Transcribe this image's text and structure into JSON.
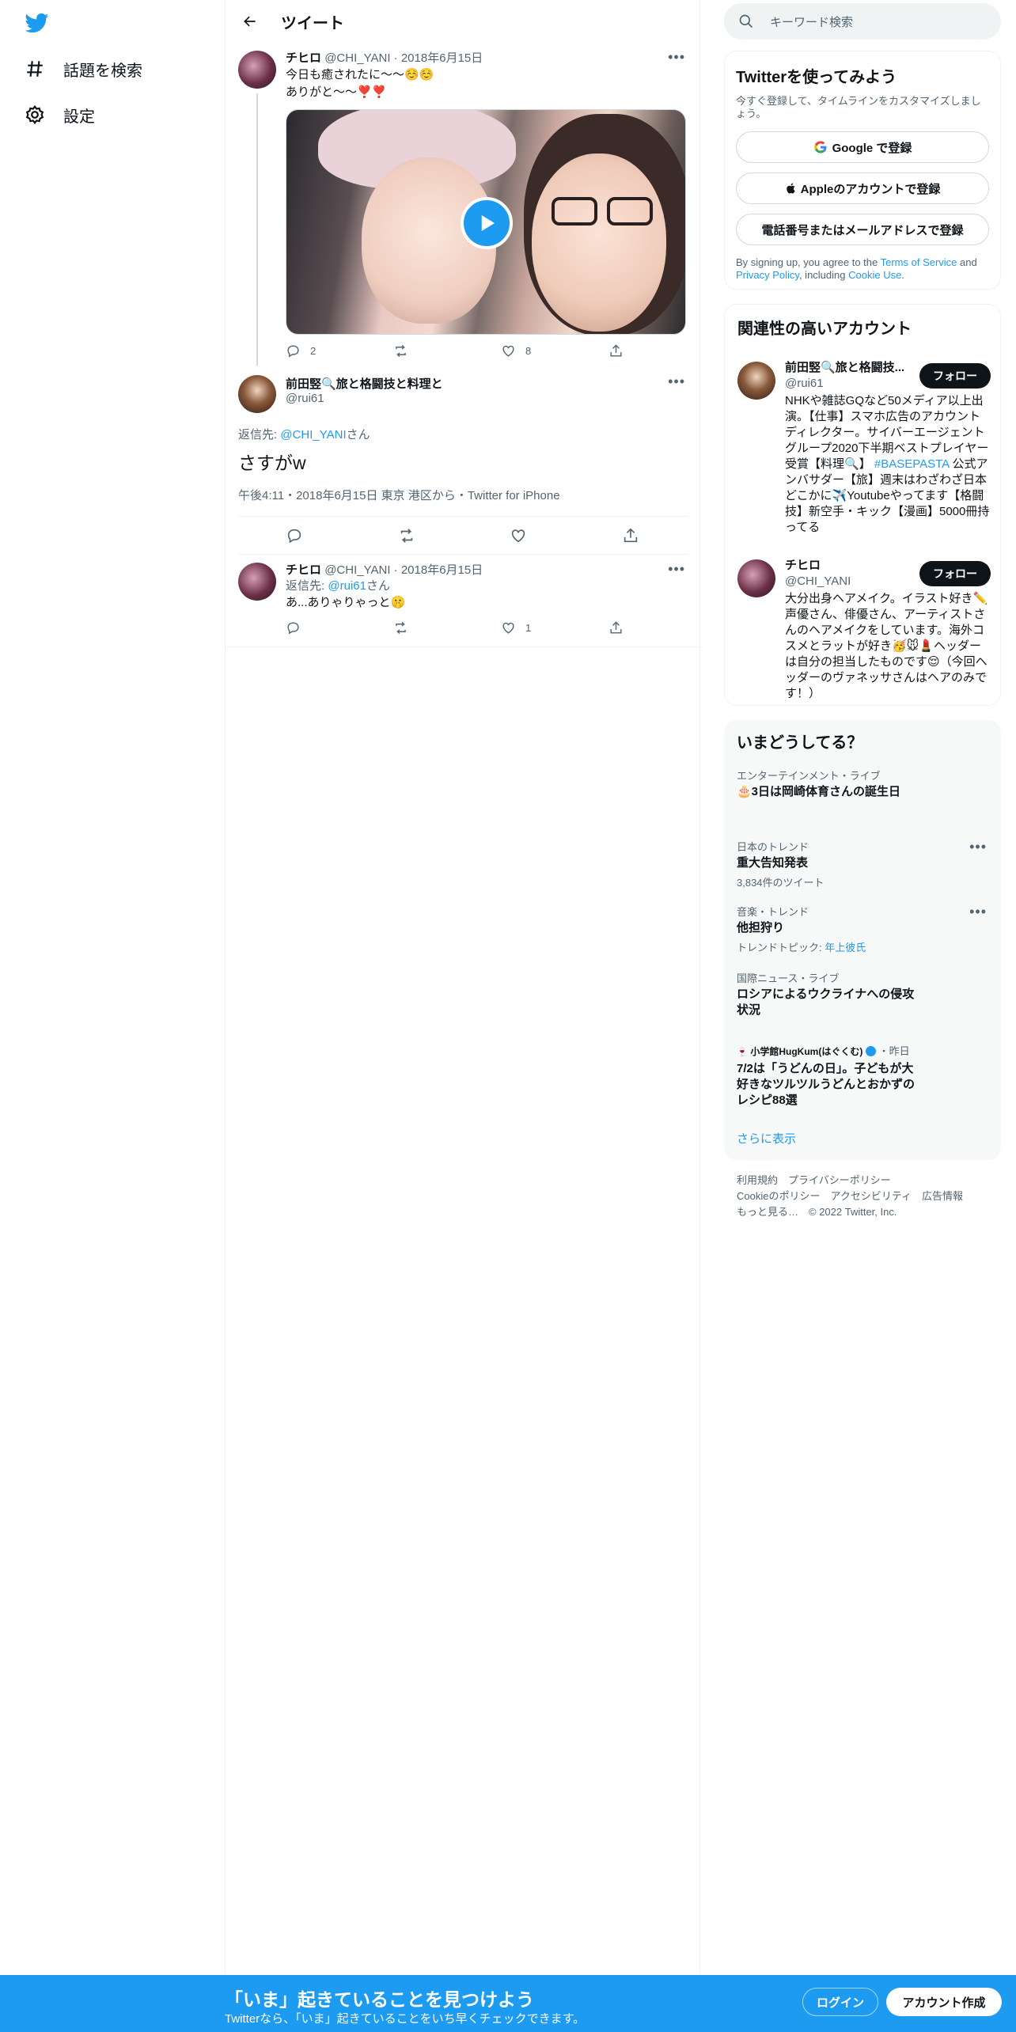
{
  "nav": {
    "explore_label": "話題を検索",
    "settings_label": "設定"
  },
  "header": {
    "title": "ツイート"
  },
  "tweet1": {
    "name": "チヒロ",
    "handle": "@CHI_YANI",
    "date": "2018年6月15日",
    "line1": "今日も癒されたに〜〜☺️☺️",
    "line2": "ありがと〜〜❣️❣️",
    "replies": "2",
    "retweets": "",
    "likes": "8"
  },
  "focus": {
    "name": "前田竪🔍旅と格闘技と料理と",
    "handle": "@rui61",
    "reply_prefix": "返信先: ",
    "reply_to": "@CHI_YANI",
    "reply_suffix": "さん",
    "text": "さすがw",
    "timeline": "午後4:11・2018年6月15日 東京 港区から・Twitter for iPhone"
  },
  "tweet3": {
    "name": "チヒロ",
    "handle": "@CHI_YANI",
    "date": "2018年6月15日",
    "reply_prefix": "返信先: ",
    "reply_to": "@rui61",
    "reply_suffix": "さん",
    "text": "あ...ありゃりゃっと🤫",
    "likes": "1"
  },
  "search": {
    "placeholder": "キーワード検索"
  },
  "signup_card": {
    "title": "Twitterを使ってみよう",
    "desc": "今すぐ登録して、タイムラインをカスタマイズしましょう。",
    "google": "Google で登録",
    "apple": "Appleのアカウントで登録",
    "phone": "電話番号またはメールアドレスで登録",
    "legal_1": "By signing up, you agree to the ",
    "terms": "Terms of Service",
    "legal_2": " and ",
    "privacy": "Privacy Policy",
    "legal_3": ", including ",
    "cookie": "Cookie Use",
    "legal_4": "."
  },
  "related": {
    "title": "関連性の高いアカウント",
    "follow_label": "フォロー",
    "accounts": [
      {
        "name": "前田竪🔍旅と格闘技...",
        "handle": "@rui61",
        "bio_1": "NHKや雑誌GQなど50メディア以上出演。【仕事】スマホ広告のアカウントディレクター。サイバーエージェントグループ2020下半期ベストプレイヤー受賞【料理🔍】",
        "bio_tag": " #BASEPASTA",
        "bio_2": " 公式アンバサダー【旅】週末はわざわざ日本どこかに✈️Youtubeやってます【格闘技】新空手・キック【漫画】5000冊持ってる"
      },
      {
        "name": "チヒロ",
        "handle": "@CHI_YANI",
        "bio_1": "大分出身ヘアメイク。イラスト好き✏️声優さん、俳優さん、アーティストさんのヘアメイクをしています。海外コスメとラットが好き🥳🐭💄ヘッダーは自分の担当したものです😌（今回ヘッダーのヴァネッサさんはヘアのみです！）"
      }
    ]
  },
  "trends": {
    "title": "いまどうしてる？",
    "items": [
      {
        "cat": "エンターテインメント・ライブ",
        "title": "🎂3日は岡崎体育さんの誕生日",
        "sub": ""
      },
      {
        "cat": "日本のトレンド",
        "title": "重大告知発表",
        "sub": "3,834件のツイート"
      },
      {
        "cat": "音楽・トレンド",
        "title": "他担狩り",
        "sub_prefix": "トレンドトピック: ",
        "sub_link": "年上彼氏"
      },
      {
        "cat": "国際ニュース・ライブ",
        "title": "ロシアによるウクライナへの侵攻状況",
        "sub": ""
      },
      {
        "cat_account": "小学館HugKum(はぐくむ)",
        "cat_time": "・昨日",
        "title": "7/2は「うどんの日」。子どもが大好きなツルツルうどんとおかずのレシピ88選"
      }
    ],
    "more": "さらに表示"
  },
  "footer": {
    "line1": "利用規約　プライバシーポリシー",
    "line2": "Cookieのポリシー　アクセシビリティ　広告情報",
    "line3": "もっと見る…　© 2022 Twitter, Inc."
  },
  "bottombar": {
    "title": "「いま」起きていることを見つけよう",
    "sub": "Twitterなら、「いま」起きていることをいち早くチェックできます。",
    "login": "ログイン",
    "signup": "アカウント作成"
  },
  "colors": {
    "accent": "#1d9bf0",
    "text": "#0f1419",
    "muted": "#536471"
  }
}
